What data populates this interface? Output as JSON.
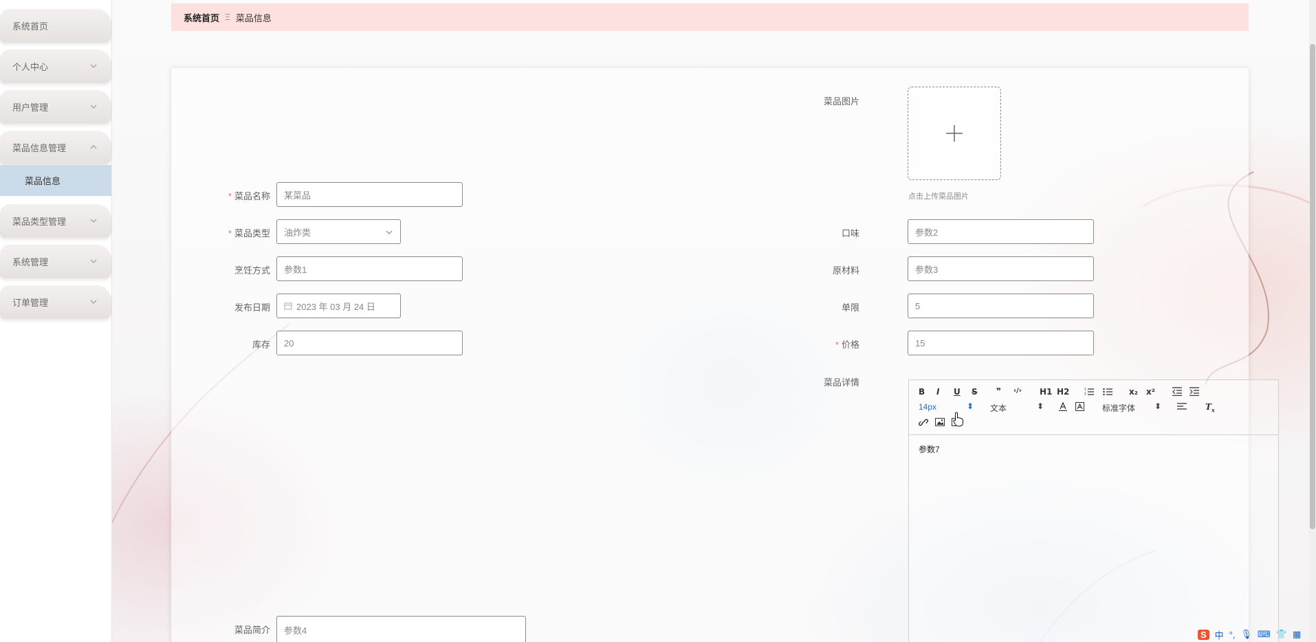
{
  "sidebar": {
    "items": [
      {
        "label": "系统首页",
        "expandable": false
      },
      {
        "label": "个人中心",
        "expandable": true
      },
      {
        "label": "用户管理",
        "expandable": true
      },
      {
        "label": "菜品信息管理",
        "expandable": true,
        "expanded": true
      },
      {
        "label": "菜品类型管理",
        "expandable": true
      },
      {
        "label": "系统管理",
        "expandable": true
      },
      {
        "label": "订单管理",
        "expandable": true
      }
    ],
    "submenu_active": "菜品信息"
  },
  "breadcrumb": {
    "home": "系统首页",
    "separator": "Ξ",
    "current": "菜品信息"
  },
  "form": {
    "dish_name": {
      "label": "菜品名称",
      "value": "某菜品",
      "required": true
    },
    "dish_type": {
      "label": "菜品类型",
      "value": "油炸类",
      "required": true
    },
    "cooking_method": {
      "label": "烹饪方式",
      "value": "参数1"
    },
    "release_date": {
      "label": "发布日期",
      "value": "2023 年 03 月 24 日"
    },
    "stock": {
      "label": "库存",
      "value": "20"
    },
    "intro": {
      "label": "菜品简介",
      "value": "参数4"
    },
    "image": {
      "label": "菜品图片",
      "upload_tip": "点击上传菜品图片"
    },
    "taste": {
      "label": "口味",
      "value": "参数2"
    },
    "ingredients": {
      "label": "原材料",
      "value": "参数3"
    },
    "limit": {
      "label": "单限",
      "value": "5"
    },
    "price": {
      "label": "价格",
      "value": "15",
      "required": true
    },
    "details": {
      "label": "菜品详情",
      "content": "参数7"
    }
  },
  "editor_toolbar": {
    "row1": [
      "B",
      "I",
      "U",
      "S",
      "❞",
      "‹/›",
      "H1",
      "H2",
      "ol",
      "ul",
      "x₂",
      "x²",
      "outdent",
      "indent"
    ],
    "font_size": "14px",
    "text_style": "文本",
    "font_family": "标准字体"
  },
  "ime": {
    "logo": "S",
    "lang": "中"
  },
  "colors": {
    "accent": "#ccdbe9",
    "breadcrumb_bg": "#fde1de",
    "required": "#f56c6c",
    "ime_blue": "#1464c8"
  }
}
